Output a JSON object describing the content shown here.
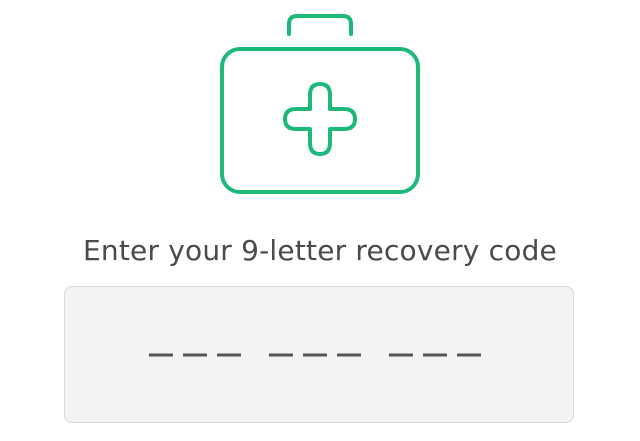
{
  "header": {
    "icon": "first-aid-kit-icon",
    "icon_color": "#1db97a"
  },
  "prompt": {
    "title": "Enter your 9-letter recovery code"
  },
  "code_input": {
    "value": "",
    "placeholder": "___ ___ ___",
    "max_length": 9,
    "groups": 3,
    "group_size": 3
  }
}
